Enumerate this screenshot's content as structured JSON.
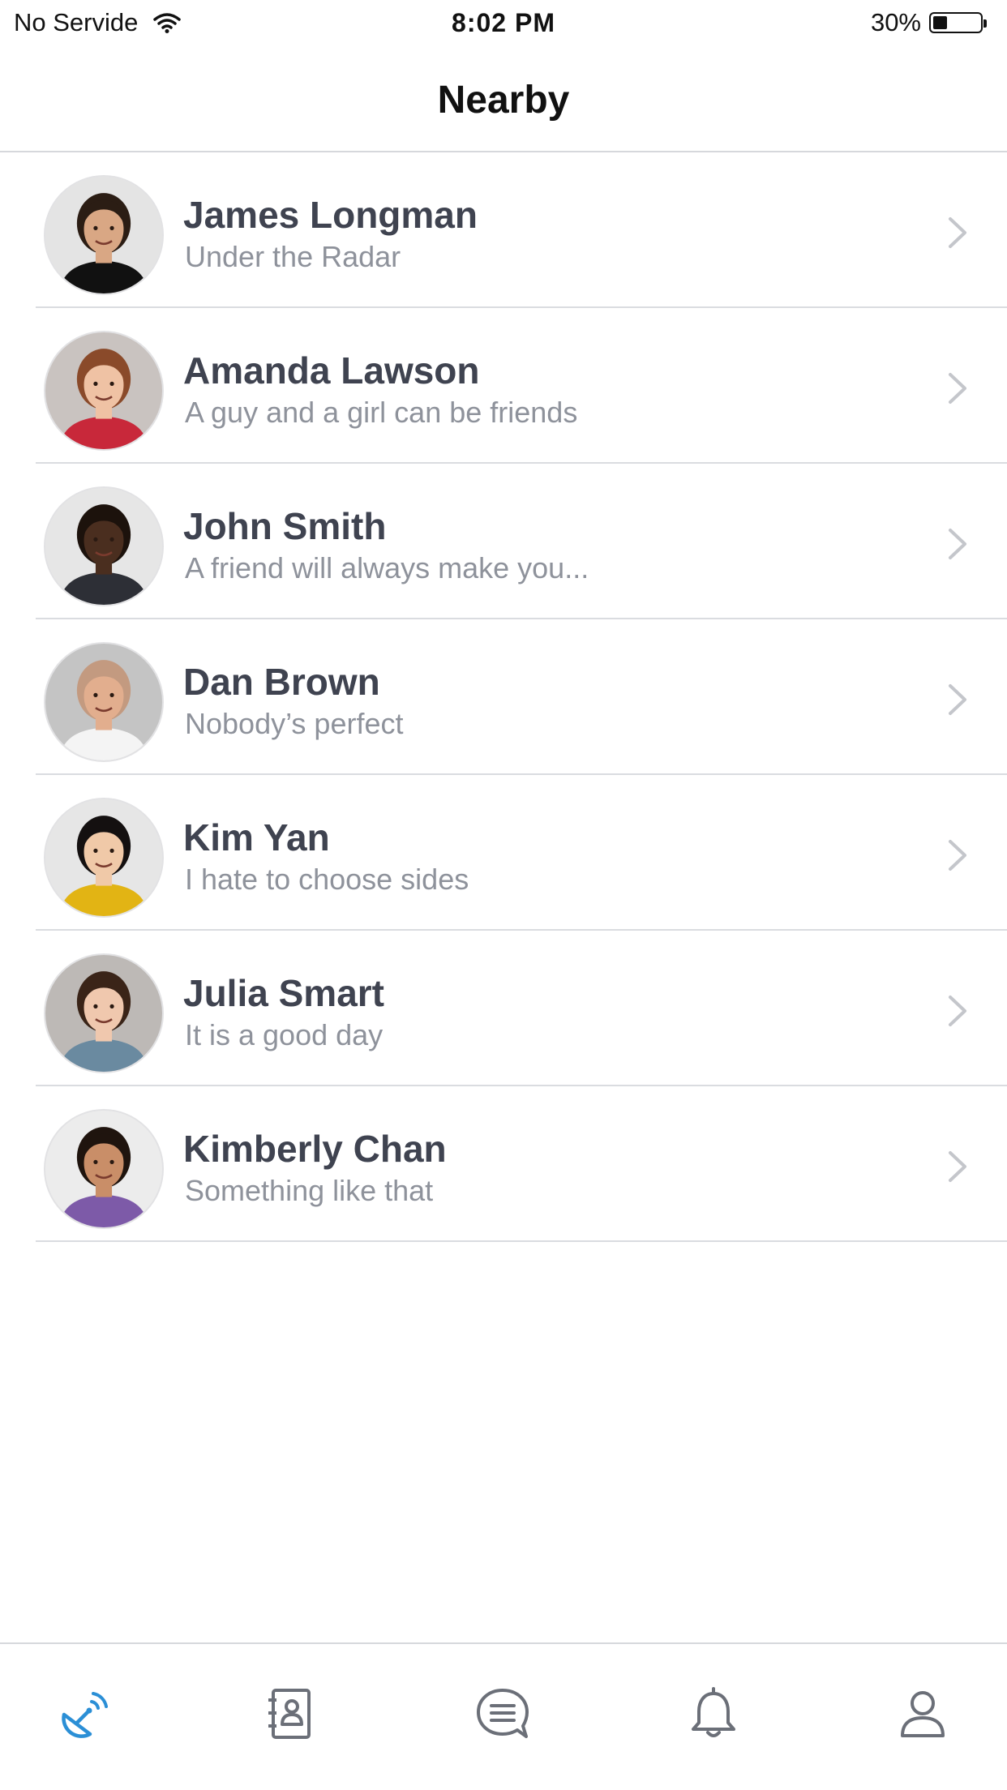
{
  "status_bar": {
    "carrier": "No Servide",
    "time": "8:02 PM",
    "battery_percent": "30%",
    "battery_level": 0.3,
    "wifi_icon": "wifi-icon"
  },
  "header": {
    "title": "Nearby"
  },
  "contacts": [
    {
      "name": "James Longman",
      "status": "Under the Radar",
      "avatar": {
        "bg": "#e4e4e4",
        "skin": "#d9a784",
        "hair": "#2b1d14",
        "shirt": "#111111"
      }
    },
    {
      "name": "Amanda Lawson",
      "status": "A guy and a girl can be friends",
      "avatar": {
        "bg": "#c9c3c0",
        "skin": "#efc2a4",
        "hair": "#8a4a2a",
        "shirt": "#c8283a"
      }
    },
    {
      "name": "John Smith",
      "status": "A friend will always make you...",
      "avatar": {
        "bg": "#e6e6e6",
        "skin": "#4a2e1f",
        "hair": "#1c120c",
        "shirt": "#2d2f36"
      }
    },
    {
      "name": "Dan Brown",
      "status": "Nobody’s perfect",
      "avatar": {
        "bg": "#c4c4c4",
        "skin": "#e2ae8e",
        "hair": "#c39a80",
        "shirt": "#f4f4f4"
      }
    },
    {
      "name": "Kim Yan",
      "status": "I hate to choose sides",
      "avatar": {
        "bg": "#e6e6e6",
        "skin": "#f0c9a8",
        "hair": "#141010",
        "shirt": "#e2b414"
      }
    },
    {
      "name": "Julia Smart",
      "status": "It is a good day",
      "avatar": {
        "bg": "#bdb9b6",
        "skin": "#f0c8ae",
        "hair": "#3a2418",
        "shirt": "#6a8aa0"
      }
    },
    {
      "name": "Kimberly Chan",
      "status": "Something like that",
      "avatar": {
        "bg": "#ececec",
        "skin": "#c98e68",
        "hair": "#1f140e",
        "shirt": "#7d5aa8"
      }
    }
  ],
  "tabs": [
    {
      "icon": "satellite-dish-icon",
      "active": true
    },
    {
      "icon": "contacts-book-icon",
      "active": false
    },
    {
      "icon": "chat-bubble-icon",
      "active": false
    },
    {
      "icon": "bell-icon",
      "active": false
    },
    {
      "icon": "user-profile-icon",
      "active": false
    }
  ],
  "colors": {
    "active_tab": "#2b8fd6",
    "inactive_tab": "#6b6f78",
    "name_text": "#3f4350",
    "status_text": "#8e929b",
    "divider": "#dadce0"
  }
}
